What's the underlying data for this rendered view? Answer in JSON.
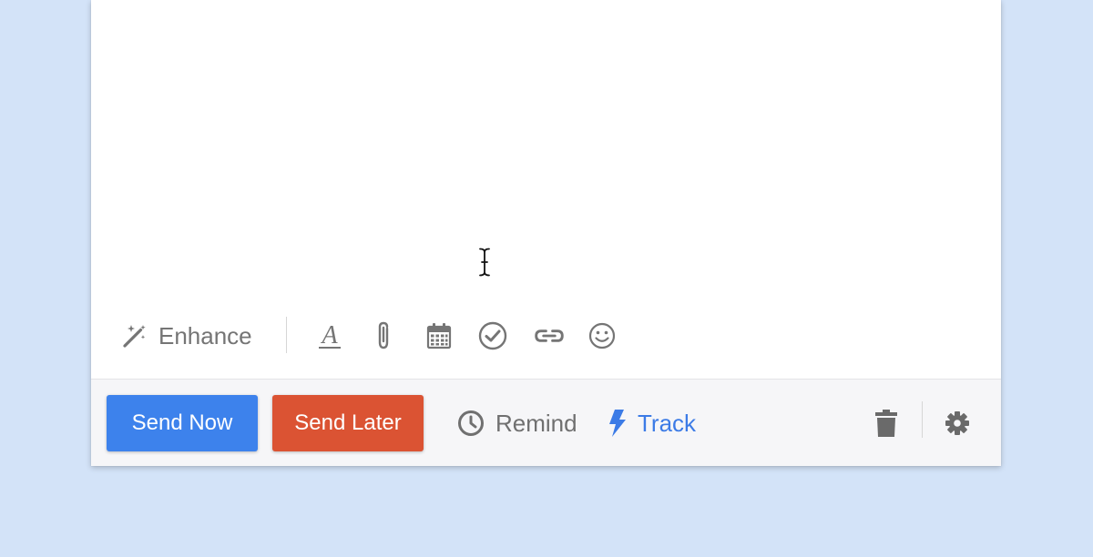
{
  "composer": {
    "toolbar": {
      "enhance_label": "Enhance",
      "icons": [
        "magic-wand-icon",
        "text-format-icon",
        "paperclip-icon",
        "calendar-icon",
        "checkmark-circle-icon",
        "link-icon",
        "emoji-icon"
      ]
    },
    "actions": {
      "send_now_label": "Send Now",
      "send_later_label": "Send Later",
      "remind_label": "Remind",
      "track_label": "Track",
      "icons": [
        "clock-icon",
        "lightning-bolt-icon",
        "trash-icon",
        "gear-icon"
      ]
    },
    "colors": {
      "background": "#d3e3f8",
      "send_now": "#3d82ec",
      "send_later": "#db5333",
      "track": "#3c7be6",
      "icon_gray": "#757575"
    }
  }
}
